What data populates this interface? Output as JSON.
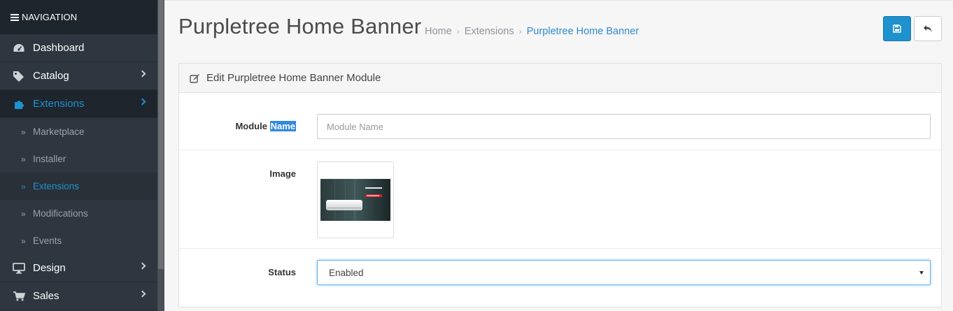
{
  "sidebar": {
    "header": "NAVIGATION",
    "items": [
      {
        "label": "Dashboard",
        "icon": "dashboard-icon",
        "active": false,
        "has_children": false
      },
      {
        "label": "Catalog",
        "icon": "tags-icon",
        "active": false,
        "has_children": true
      },
      {
        "label": "Extensions",
        "icon": "puzzle-icon",
        "active": true,
        "has_children": true
      },
      {
        "label": "Design",
        "icon": "desktop-icon",
        "active": false,
        "has_children": true
      },
      {
        "label": "Sales",
        "icon": "cart-icon",
        "active": false,
        "has_children": true
      }
    ],
    "subitems": [
      {
        "label": "Marketplace",
        "active": false
      },
      {
        "label": "Installer",
        "active": false
      },
      {
        "label": "Extensions",
        "active": true
      },
      {
        "label": "Modifications",
        "active": false
      },
      {
        "label": "Events",
        "active": false
      }
    ]
  },
  "header": {
    "title": "Purpletree Home Banner",
    "breadcrumb": [
      "Home",
      "Extensions",
      "Purpletree Home Banner"
    ]
  },
  "panel": {
    "heading": "Edit Purpletree Home Banner Module",
    "fields": {
      "module_name_label_1": "Module",
      "module_name_label_2": "Name",
      "module_name_placeholder": "Module Name",
      "module_name_value": "",
      "image_label": "Image",
      "status_label": "Status",
      "status_value": "Enabled"
    }
  },
  "colors": {
    "accent": "#1e91cf",
    "sidebar_bg": "#2f3640",
    "sidebar_header_bg": "#1f252c"
  }
}
